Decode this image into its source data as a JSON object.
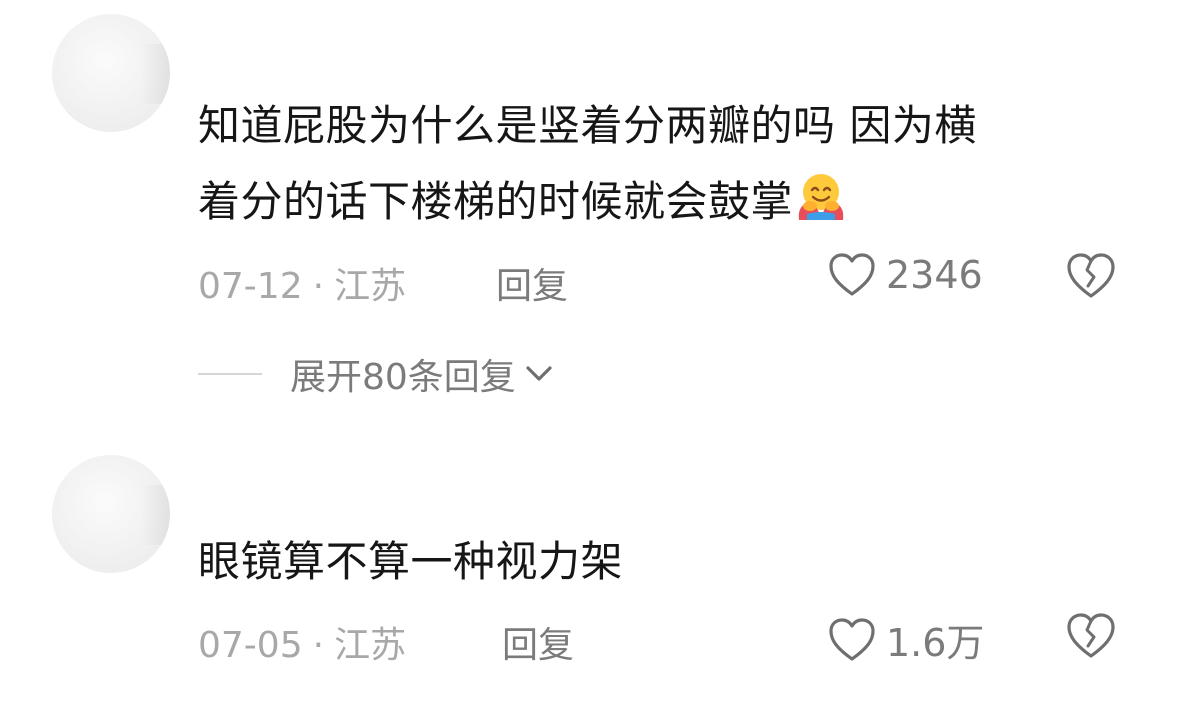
{
  "comments": [
    {
      "username": "",
      "text_line1": "知道屁股为什么是竖着分两瓣的吗 因为横",
      "text_line2": "着分的话下楼梯的时候就会鼓掌",
      "emoji": "hugging-face-emoji",
      "date": "07-12",
      "separator": "·",
      "location": "江苏",
      "reply_label": "回复",
      "likes": "2346",
      "expand_label": "展开80条回复"
    },
    {
      "username": "",
      "text_line1": "眼镜算不算一种视力架",
      "date": "07-05",
      "separator": "·",
      "location": "江苏",
      "reply_label": "回复",
      "likes": "1.6万"
    }
  ],
  "icons": {
    "like": "heart-outline-icon",
    "dislike": "broken-heart-outline-icon",
    "expand": "chevron-down-icon"
  },
  "colors": {
    "text": "#161616",
    "meta": "#a8a8a8",
    "action": "#7b7b7b"
  }
}
